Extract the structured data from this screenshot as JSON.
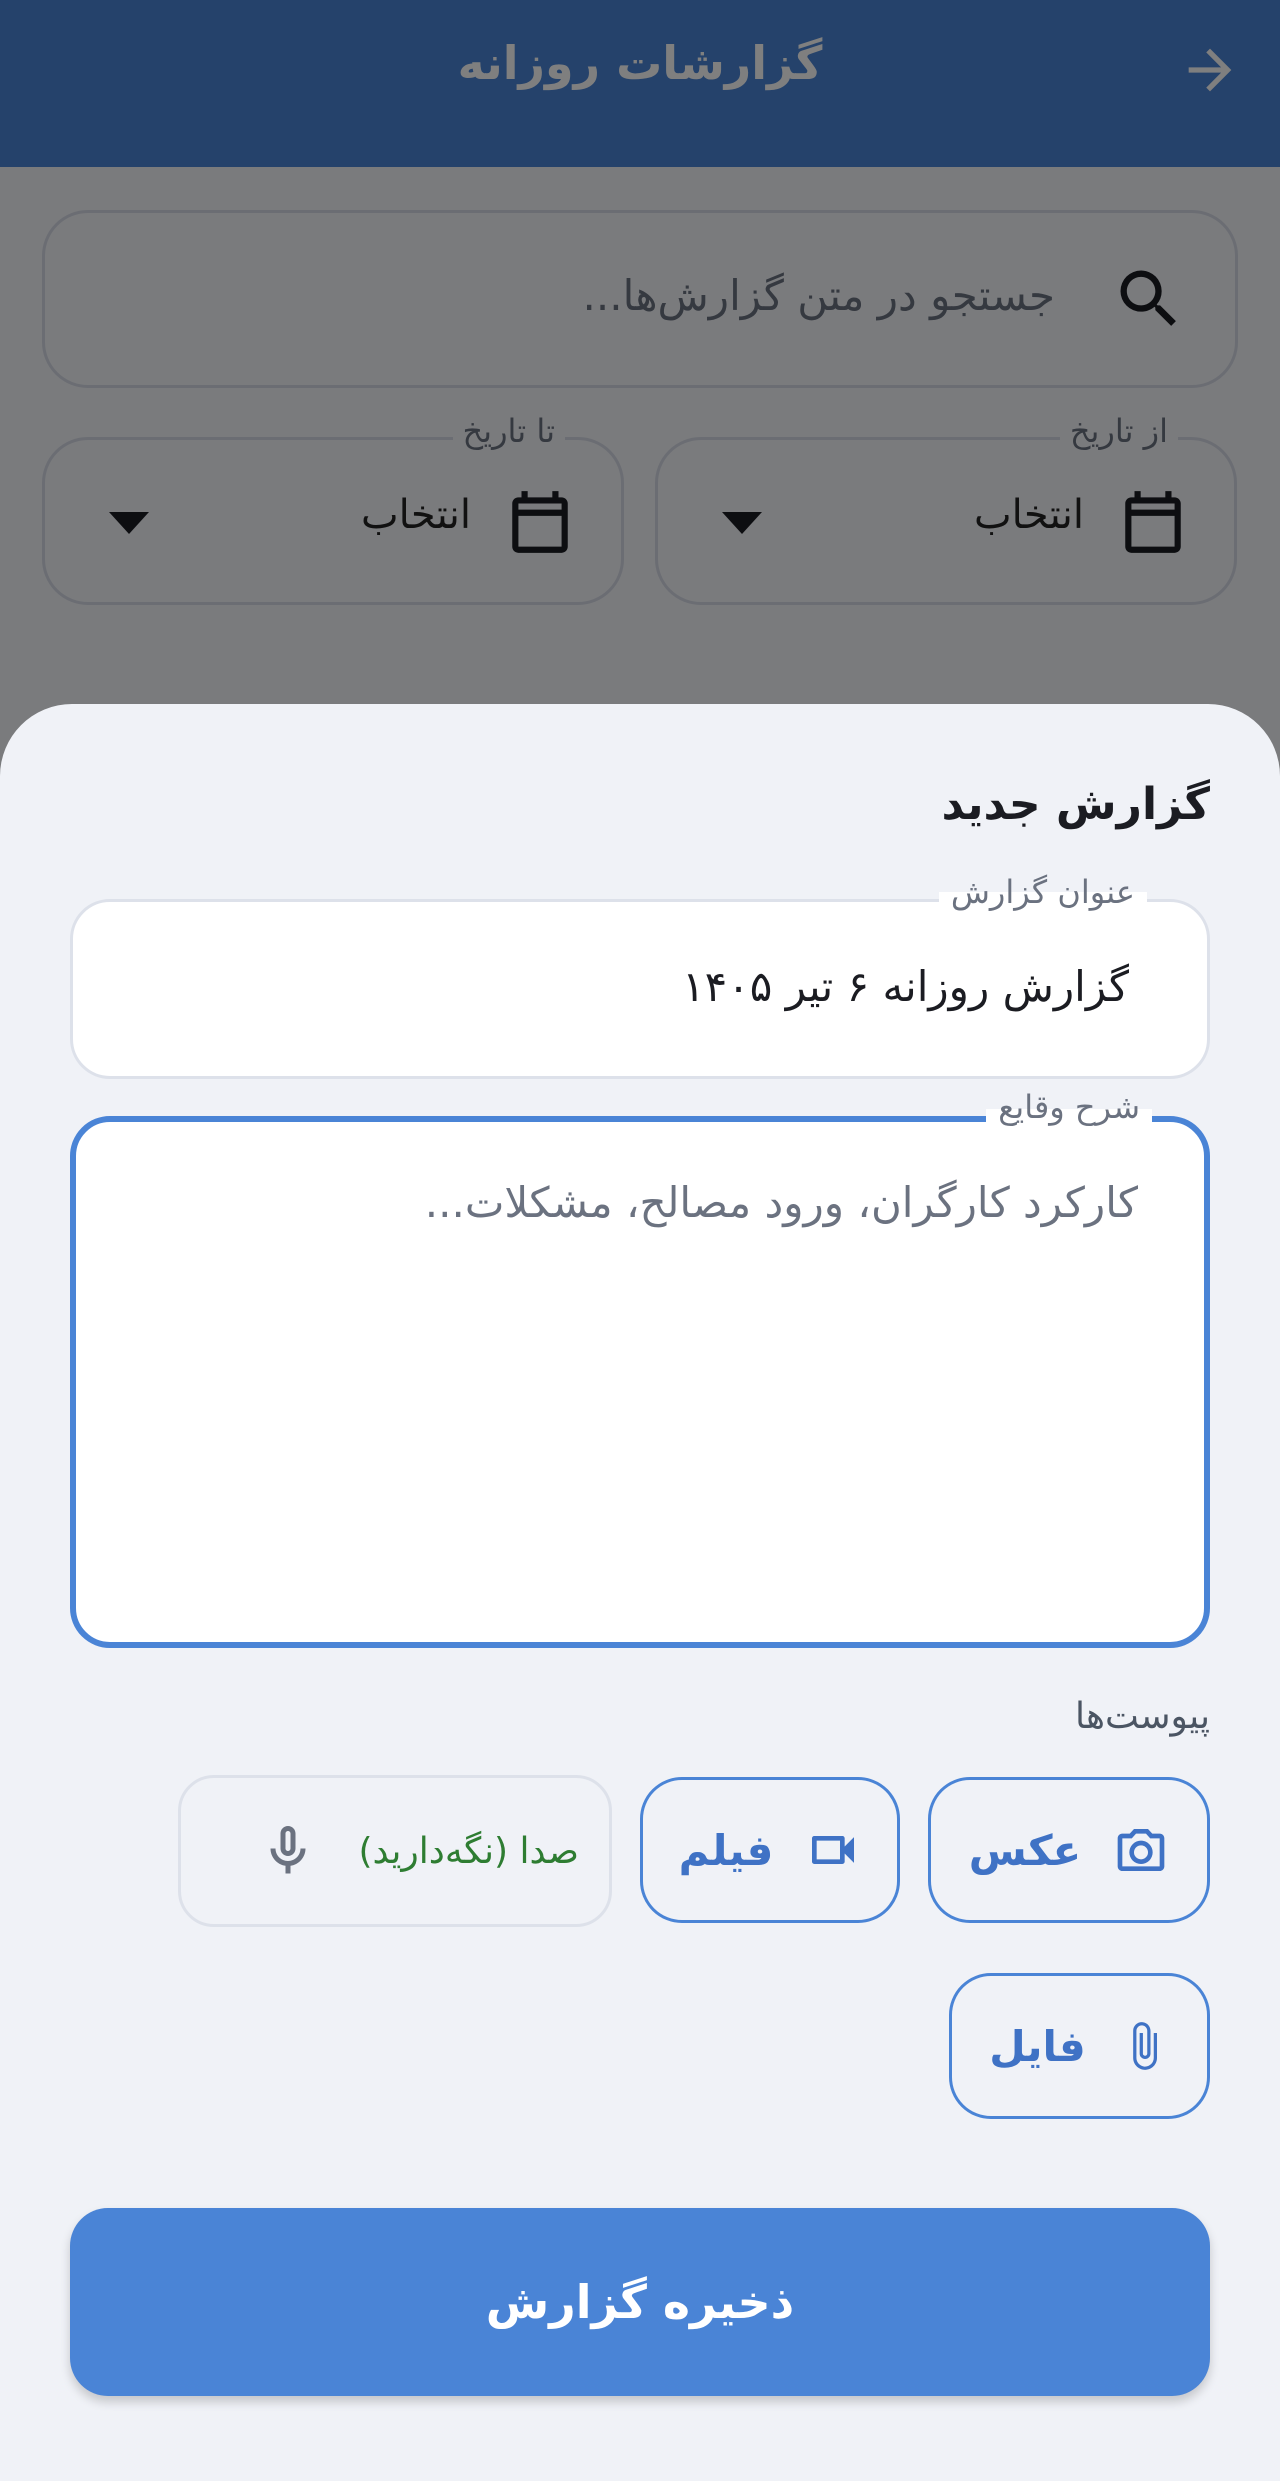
{
  "app_bar": {
    "title": "گزارشات روزانه"
  },
  "search": {
    "placeholder": "جستجو در متن گزارش‌ها..."
  },
  "filters": {
    "from_date": {
      "label": "از تاریخ",
      "value": "انتخاب"
    },
    "to_date": {
      "label": "تا تاریخ",
      "value": "انتخاب"
    }
  },
  "sheet": {
    "title": "گزارش جدید",
    "report_title": {
      "label": "عنوان گزارش",
      "value": "گزارش روزانه ۶ تیر ۱۴۰۵"
    },
    "description": {
      "label": "شرح وقایع",
      "placeholder": "کارکرد کارگران، ورود مصالح، مشکلات..."
    },
    "attachments": {
      "label": "پیوست‌ها",
      "photo_label": "عکس",
      "video_label": "فیلم",
      "voice_label": "صدا (نگه‌دارید)",
      "file_label": "فایل"
    },
    "save_label": "ذخیره گزارش"
  },
  "icons": {
    "back": "arrow-forward-icon",
    "search": "search-icon",
    "calendar": "calendar-icon",
    "dropdown": "dropdown-arrow-icon",
    "photo": "camera-icon",
    "video": "videocam-icon",
    "voice": "microphone-icon",
    "file": "paperclip-icon"
  },
  "colors": {
    "primary": "#4a84d6",
    "voice_text": "#2e7d32",
    "background": "#f0f2f7"
  }
}
